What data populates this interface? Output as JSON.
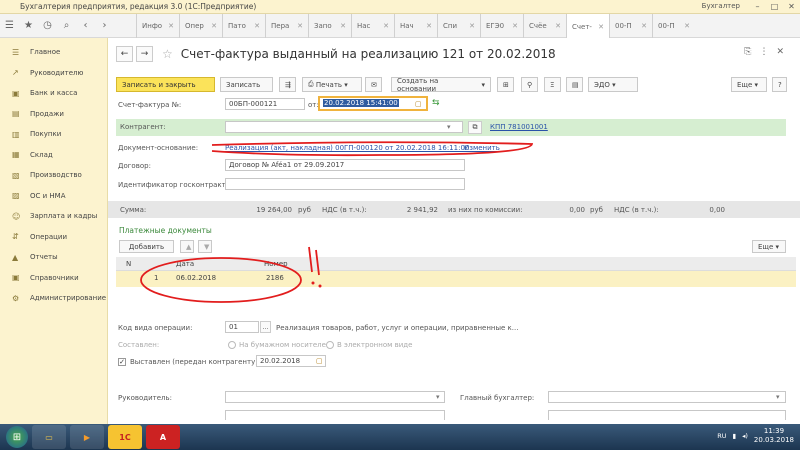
{
  "window": {
    "app_title": "Бухгалтерия предприятия, редакция 3.0 (1С:Предприятие)",
    "user": "Бухгалтер"
  },
  "tabs": [
    {
      "label": "Инфо"
    },
    {
      "label": "Опер"
    },
    {
      "label": "Пато"
    },
    {
      "label": "Пера"
    },
    {
      "label": "Запо"
    },
    {
      "label": "Нас"
    },
    {
      "label": "Нач"
    },
    {
      "label": "Спи"
    },
    {
      "label": "ЕГЭ0"
    },
    {
      "label": "Счёе"
    },
    {
      "label": "Счет-"
    },
    {
      "label": "00-П"
    },
    {
      "label": "00-П"
    }
  ],
  "sidebar": {
    "items": [
      {
        "label": "Главное",
        "icon": "menu-icon"
      },
      {
        "label": "Руководителю",
        "icon": "chart-icon"
      },
      {
        "label": "Банк и касса",
        "icon": "bank-icon"
      },
      {
        "label": "Продажи",
        "icon": "cart-icon"
      },
      {
        "label": "Покупки",
        "icon": "basket-icon"
      },
      {
        "label": "Склад",
        "icon": "warehouse-icon"
      },
      {
        "label": "Производство",
        "icon": "factory-icon"
      },
      {
        "label": "ОС и НМА",
        "icon": "building-icon"
      },
      {
        "label": "Зарплата и кадры",
        "icon": "people-icon"
      },
      {
        "label": "Операции",
        "icon": "operations-icon"
      },
      {
        "label": "Отчеты",
        "icon": "report-icon"
      },
      {
        "label": "Справочники",
        "icon": "book-icon"
      },
      {
        "label": "Администрирование",
        "icon": "gear-icon"
      }
    ]
  },
  "document": {
    "title": "Счет-фактура выданный на реализацию 121 от 20.02.2018"
  },
  "toolbar": {
    "save_close": "Записать и закрыть",
    "write": "Записать",
    "print": "Печать",
    "create_based": "Создать на основании",
    "edo": "ЭДО",
    "more": "Еще"
  },
  "form": {
    "invoice_label": "Счет-фактура №:",
    "invoice_number": "00БП-000121",
    "from_label": "от:",
    "date": "20.02.2018 15:41:00",
    "counterparty_label": "Контрагент:",
    "kpp_link": "КПП 781001001",
    "basis_label": "Документ-основание:",
    "basis_link": "Реализация (акт, накладная) 00ГП-000120 от 20.02.2018 16:11:00",
    "change_link": "Изменить",
    "contract_label": "Договор:",
    "contract_value": "Договор № Aféa1 от 29.09.2017",
    "gov_id_label": "Идентификатор госконтракта:"
  },
  "sums": {
    "label": "Сумма:",
    "amount": "19 264,00",
    "currency1": "руб",
    "vat_label": "НДС (в т.ч.):",
    "vat": "2 941,92",
    "commission_label": "из них по комиссии:",
    "commission": "0,00",
    "currency2": "руб",
    "commission_vat_label": "НДС (в т.ч.):",
    "commission_vat": "0,00"
  },
  "payments": {
    "title": "Платежные документы",
    "add": "Добавить",
    "more": "Еще",
    "col_n": "N",
    "col_date": "Дата",
    "col_number": "Номер",
    "rows": [
      {
        "n": "1",
        "date": "06.02.2018",
        "number": "2186"
      }
    ]
  },
  "operation": {
    "code_label": "Код вида операции:",
    "code": "01",
    "code_desc": "Реализация товаров, работ, услуг и операции, приравненные к...",
    "composed_label": "Составлен:",
    "paper": "На бумажном носителе",
    "electronic": "В электронном виде",
    "issued_label": "Выставлен (передан контрагенту):",
    "issued_date": "20.02.2018"
  },
  "signatures": {
    "head_label": "Руководитель:",
    "accountant_label": "Главный бухгалтер:"
  },
  "taskbar": {
    "lang": "RU",
    "time": "11:39",
    "date": "20.03.2018"
  },
  "colors": {
    "accent_yellow": "#fbe35a",
    "sidebar_bg": "#fcf3cf",
    "annotation_red": "#e21d1d"
  }
}
